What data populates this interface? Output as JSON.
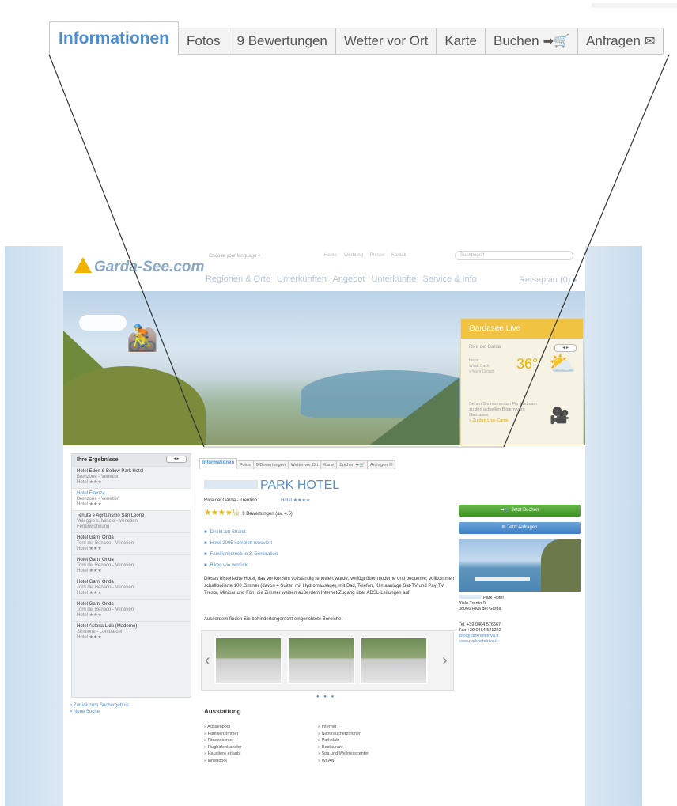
{
  "zoom_tabs": [
    {
      "label": "Informationen",
      "active": true
    },
    {
      "label": "Fotos"
    },
    {
      "label": "9 Bewertungen"
    },
    {
      "label": "Wetter vor Ort"
    },
    {
      "label": "Karte"
    },
    {
      "label": "Buchen",
      "icon": "cart-icon",
      "glyph": "➡🛒"
    },
    {
      "label": "Anfragen",
      "icon": "envelope-icon",
      "glyph": "✉"
    }
  ],
  "site": {
    "logo": "Garda-See.com",
    "language": "Choose your language ▾",
    "top_links": [
      "Home",
      "Werbung",
      "Presse",
      "Kontakt"
    ],
    "search_placeholder": "Suchbegriff",
    "main_nav": [
      "Regionen & Orte",
      "Unterkünften",
      "Angebot",
      "Unterkünfte",
      "Service & Info"
    ],
    "reiseplan": "Reiseplan (0) ▸",
    "weather": {
      "title": "Gardasee Live",
      "location": "Riva del Garda",
      "arrows": "◂ ▸",
      "small": "heute\nWind: Bach\n» Mehr Details",
      "temp": "36°",
      "cam_text": "Sehen Sie momentan Per Webcam zu den aktuellen Bildern vom Gardasee.",
      "cam_link": "» Zu den Live-Cams"
    },
    "sidebar": {
      "title": "Ihre Ergebnisse",
      "arrows": "◂ ▸",
      "items": [
        {
          "name": "Hotel Eden & Bellow Park Hotel",
          "loc": "Brenzone - Venetien",
          "stars": "Hotel ★★★",
          "hl": false
        },
        {
          "name": "Hotel Firenze",
          "loc": "Brenzone - Venetien",
          "stars": "Hotel ★★★",
          "hl": true
        },
        {
          "name": "Tenuta e Agriturismo San Leone",
          "loc": "Valeggio s. Mincio - Venetien",
          "stars": "Ferienwohnung",
          "hl": false
        },
        {
          "name": "Hotel Garni Onda",
          "loc": "Torri del Benaco - Venetien",
          "stars": "Hotel ★★★",
          "hl": false
        },
        {
          "name": "Hotel Garni Onda",
          "loc": "Torri del Benaco - Venetien",
          "stars": "Hotel ★★★",
          "hl": false
        },
        {
          "name": "Hotel Garni Onda",
          "loc": "Torri del Benaco - Venetien",
          "stars": "Hotel ★★★",
          "hl": false
        },
        {
          "name": "Hotel Garni Onda",
          "loc": "Torri del Benaco - Venetien",
          "stars": "Hotel ★★★",
          "hl": false
        },
        {
          "name": "Hotel Astoria Lido (Maderno)",
          "loc": "Sirmione - Lombardei",
          "stars": "Hotel ★★★",
          "hl": false
        }
      ],
      "links": [
        "« Zurück zum Suchergebnis",
        "» Neue Suche"
      ]
    },
    "content": {
      "tabs": [
        "Informationen",
        "Fotos",
        "9 Bewertungen",
        "Wetter vor Ort",
        "Karte",
        "Buchen ➡🛒",
        "Anfragen ✉"
      ],
      "title": "PARK HOTEL",
      "location": "Riva del Garda - Trentino",
      "category": "Hotel ★★★★",
      "stars": "★★★★½",
      "rating": "9 Bewertungen (av. 4.5)",
      "bullets": [
        "Direkt am Strand",
        "Hotel 2005 komplett renoviert",
        "Familienbetrieb in 3. Generation",
        "Biken wie verrückt"
      ],
      "desc": "Dieses historische Hotel, das vor kurzem vollständig renoviert wurde, verfügt über moderne und bequeme, vollkommen schallisolierte 100 Zimmer (davon 4 Suiten mit Hydromassage), mit Bad, Telefon, Klimaanlage Sat-TV und Pay-TV, Tresor, Minibar und Fön, die Zimmer weisen außerdem Internet-Zugang über ADSL-Leitungen auf.",
      "desc2": "Ausserdem finden Sie behindertengerecht eingerichtete Bereiche.",
      "gallery_dots": "● ● ●",
      "ausstattung_title": "Ausstattung",
      "amen_col1": [
        "» Aussenpool",
        "» Familienzimmer",
        "» Fitnesscenter",
        "» Flughafentransfer",
        "» Haustiere erlaubt",
        "» Innenpool"
      ],
      "amen_col2": [
        "» Internet",
        "» Nichtraucherzimmer",
        "» Parkplatz",
        "» Restaurant",
        "» Spa und Wellnesscenter",
        "» WLAN"
      ],
      "btn_book": "➡🛒 Jetzt Buchen",
      "btn_ask": "✉ Jetzt Anfragen",
      "hotel_name": "Park Hotel",
      "address": [
        "Viale Trento 9",
        "38066 Riva del Garda"
      ],
      "tel": "Tel. +39 0464 576667",
      "fax": "Fax +39 0464 521222",
      "email": "info@parkhotelriva.it",
      "web": "www.parkhotelriva.it"
    }
  }
}
